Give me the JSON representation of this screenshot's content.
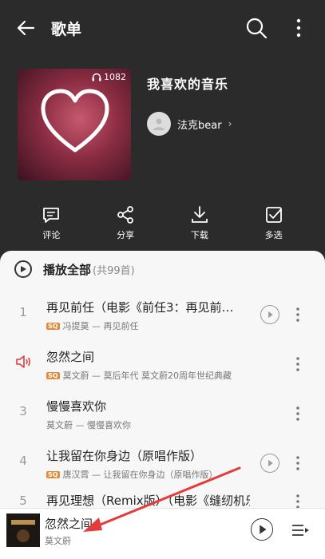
{
  "header": {
    "title": "歌单"
  },
  "playlist": {
    "play_count": "1082",
    "title": "我喜欢的音乐",
    "creator": "法克bear"
  },
  "actions": [
    {
      "label": "评论",
      "icon": "comment-icon"
    },
    {
      "label": "分享",
      "icon": "share-icon"
    },
    {
      "label": "下载",
      "icon": "download-icon"
    },
    {
      "label": "多选",
      "icon": "multi-select-icon"
    }
  ],
  "play_all": {
    "label": "播放全部",
    "count": "(共99首)"
  },
  "songs": [
    {
      "index": "1",
      "name": "再见前任（电影《前任3：再见前…",
      "badge": "SQ",
      "sub": "冯提莫 — 再见前任",
      "has_mv": true
    },
    {
      "index": "",
      "name": "忽然之间",
      "badge": "SQ",
      "sub": "莫文蔚 — 莫后年代 莫文蔚20周年世纪典藏",
      "has_mv": false,
      "playing": true
    },
    {
      "index": "3",
      "name": "慢慢喜欢你",
      "badge": "",
      "sub": "莫文蔚 — 慢慢喜欢你",
      "has_mv": false
    },
    {
      "index": "4",
      "name": "让我留在你身边（原唱作版）",
      "badge": "SQ",
      "sub": "唐汉霄 — 让我留在你身边（原唱作版）",
      "has_mv": true
    },
    {
      "index": "5",
      "name": "再见理想（Remix版）（电影《缝纫机乐…",
      "badge": "",
      "sub": "",
      "has_mv": false
    }
  ],
  "mini_player": {
    "title": "忽然之间",
    "artist": "莫文蔚"
  },
  "colors": {
    "accent": "#e23b3b",
    "badge": "#e08b3a",
    "arrow": "#e63b3b"
  }
}
